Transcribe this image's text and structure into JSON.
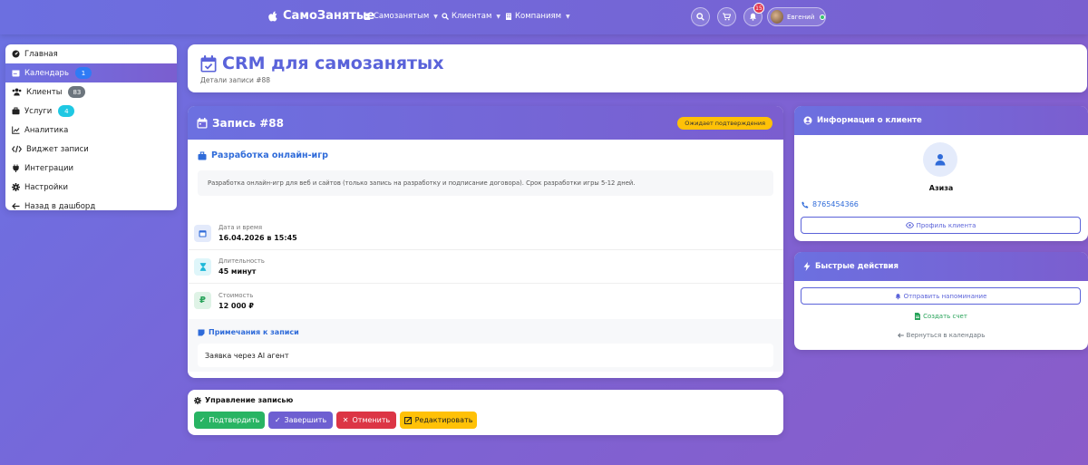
{
  "nav": {
    "brand": "СамоЗанятые",
    "menu": [
      "Самозанятым",
      "Клиентам",
      "Компаниям"
    ],
    "notif_count": "15",
    "user_name": "Евгений"
  },
  "sidebar": {
    "items": [
      {
        "label": "Главная",
        "icon": "dashboard-icon"
      },
      {
        "label": "Календарь",
        "icon": "calendar-icon",
        "badge": "1",
        "badge_color": "#2f7bf5"
      },
      {
        "label": "Клиенты",
        "icon": "users-icon",
        "badge": "83",
        "badge_color": "#6c757d"
      },
      {
        "label": "Услуги",
        "icon": "services-icon",
        "badge": "4",
        "badge_color": "#1fc8e3"
      },
      {
        "label": "Аналитика",
        "icon": "chart-icon"
      },
      {
        "label": "Виджет записи",
        "icon": "code-icon"
      },
      {
        "label": "Интеграции",
        "icon": "plug-icon"
      },
      {
        "label": "Настройки",
        "icon": "gear-icon"
      },
      {
        "label": "Назад в дашборд",
        "icon": "arrow-left-icon"
      }
    ]
  },
  "page": {
    "title": "CRM для самозанятых",
    "subtitle": "Детали записи #88"
  },
  "record": {
    "header": "Запись #88",
    "status": "Ожидает подтверждения",
    "service_title": "Разработка онлайн-игр",
    "description": "Разработка онлайн-игр для веб и сайтов (только запись на разработку и подписание договора). Срок разработки игры 5-12 дней.",
    "datetime_label": "Дата и время",
    "datetime_value": "16.04.2026 в 15:45",
    "duration_label": "Длительность",
    "duration_value": "45 минут",
    "cost_label": "Стоимость",
    "cost_value": "12 000 ₽",
    "notes_title": "Примечания к записи",
    "notes_text": "Заявка через AI агент"
  },
  "manage": {
    "title": "Управление записью",
    "confirm": "Подтвердить",
    "complete": "Завершить",
    "cancel": "Отменить",
    "edit": "Редактировать"
  },
  "client": {
    "header": "Информация о клиенте",
    "name": "Азиза",
    "phone": "8765454366",
    "profile_button": "Профиль клиента"
  },
  "quick": {
    "header": "Быстрые действия",
    "reminder": "Отправить напоминание",
    "invoice": "Создать счет",
    "back": "Вернуться в календарь"
  },
  "colors": {
    "accent": "#5b63d9",
    "success": "#28b463",
    "complete": "#6e5fd1",
    "danger": "#dc3545",
    "warning": "#ffc107"
  }
}
